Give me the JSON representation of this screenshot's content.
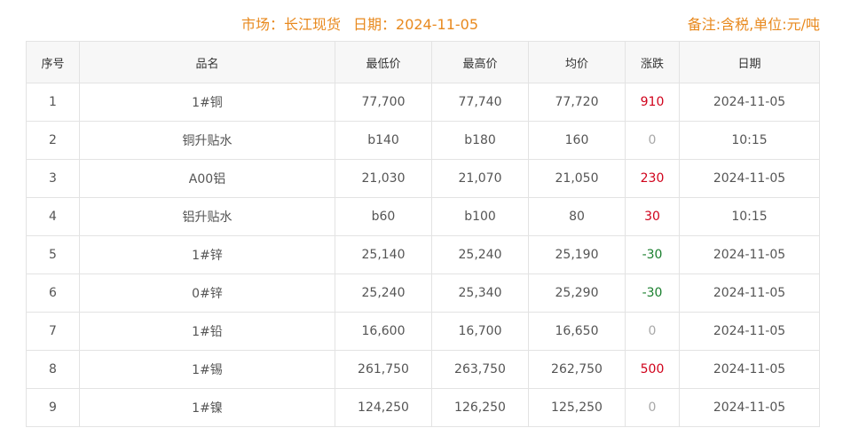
{
  "header": {
    "market": "市场：长江现货",
    "date": "日期：2024-11-05",
    "note": "备注:含税,单位:元/吨"
  },
  "table": {
    "columns": [
      "序号",
      "品名",
      "最低价",
      "最高价",
      "均价",
      "涨跌",
      "日期"
    ],
    "rows": [
      {
        "no": "1",
        "name": "1#铜",
        "low": "77,700",
        "high": "77,740",
        "avg": "77,720",
        "change": "910",
        "dir": "up",
        "date": "2024-11-05"
      },
      {
        "no": "2",
        "name": "铜升贴水",
        "low": "b140",
        "high": "b180",
        "avg": "160",
        "change": "0",
        "dir": "zero",
        "date": "10:15"
      },
      {
        "no": "3",
        "name": "A00铝",
        "low": "21,030",
        "high": "21,070",
        "avg": "21,050",
        "change": "230",
        "dir": "up",
        "date": "2024-11-05"
      },
      {
        "no": "4",
        "name": "铝升贴水",
        "low": "b60",
        "high": "b100",
        "avg": "80",
        "change": "30",
        "dir": "up",
        "date": "10:15"
      },
      {
        "no": "5",
        "name": "1#锌",
        "low": "25,140",
        "high": "25,240",
        "avg": "25,190",
        "change": "-30",
        "dir": "down",
        "date": "2024-11-05"
      },
      {
        "no": "6",
        "name": "0#锌",
        "low": "25,240",
        "high": "25,340",
        "avg": "25,290",
        "change": "-30",
        "dir": "down",
        "date": "2024-11-05"
      },
      {
        "no": "7",
        "name": "1#铅",
        "low": "16,600",
        "high": "16,700",
        "avg": "16,650",
        "change": "0",
        "dir": "zero",
        "date": "2024-11-05"
      },
      {
        "no": "8",
        "name": "1#锡",
        "low": "261,750",
        "high": "263,750",
        "avg": "262,750",
        "change": "500",
        "dir": "up",
        "date": "2024-11-05"
      },
      {
        "no": "9",
        "name": "1#镍",
        "low": "124,250",
        "high": "126,250",
        "avg": "125,250",
        "change": "0",
        "dir": "zero",
        "date": "2024-11-05"
      }
    ]
  },
  "colors": {
    "accent": "#e8891e",
    "up": "#d0021b",
    "down": "#1a7f2e",
    "zero": "#a8a8a8"
  }
}
